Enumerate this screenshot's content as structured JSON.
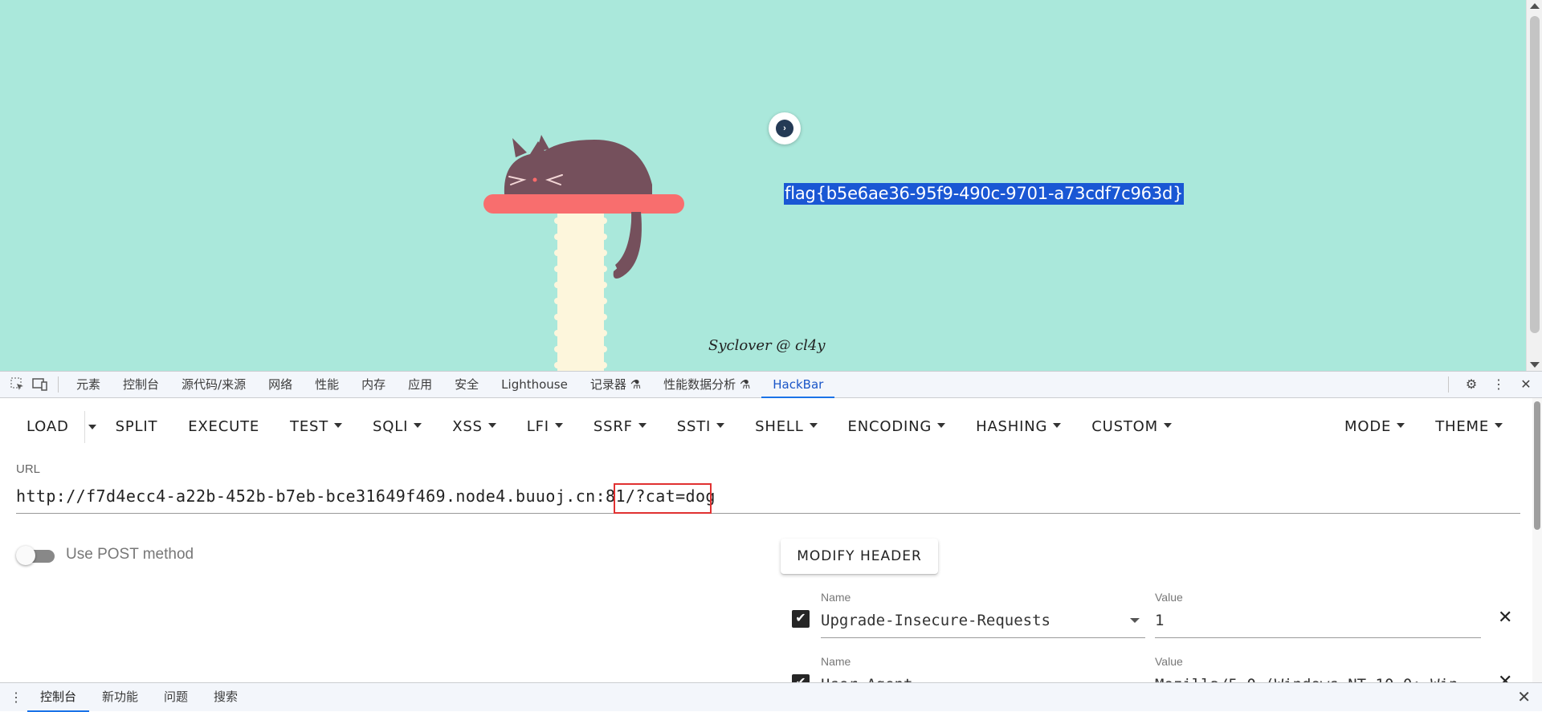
{
  "page": {
    "flag_text": "flag{b5e6ae36-95f9-490c-9701-a73cdf7c963d}",
    "credit": "Syclover @ cl4y",
    "background_color": "#aae8db"
  },
  "devtools": {
    "tabs": [
      "元素",
      "控制台",
      "源代码/来源",
      "网络",
      "性能",
      "内存",
      "应用",
      "安全",
      "Lighthouse",
      "记录器 ⚗",
      "性能数据分析 ⚗",
      "HackBar"
    ],
    "active_tab": "HackBar",
    "icons": [
      "inspect-icon",
      "device-toggle-icon",
      "gear-icon",
      "more-vert-icon",
      "close-icon"
    ]
  },
  "hackbar": {
    "toolbar": {
      "load": "LOAD",
      "split": "SPLIT",
      "execute": "EXECUTE",
      "test": "TEST",
      "sqli": "SQLI",
      "xss": "XSS",
      "lfi": "LFI",
      "ssrf": "SSRF",
      "ssti": "SSTI",
      "shell": "SHELL",
      "encoding": "ENCODING",
      "hashing": "HASHING",
      "custom": "CUSTOM",
      "mode": "MODE",
      "theme": "THEME"
    },
    "url_label": "URL",
    "url_value": "http://f7d4ecc4-a22b-452b-b7eb-bce31649f469.node4.buuoj.cn:81/?cat=dog",
    "url_highlighted_part": "/?cat=dog",
    "post_toggle_label": "Use POST method",
    "post_enabled": false,
    "modify_header_label": "MODIFY HEADER",
    "headers": [
      {
        "checked": true,
        "name_label": "Name",
        "name": "Upgrade-Insecure-Requests",
        "value_label": "Value",
        "value": "1"
      },
      {
        "checked": true,
        "name_label": "Name",
        "name": "User-Agent",
        "value_label": "Value",
        "value": "Mozilla/5.0 (Windows NT 10.0; Win"
      }
    ]
  },
  "drawer": {
    "tabs": [
      "控制台",
      "新功能",
      "问题",
      "搜索"
    ],
    "active_tab": "控制台"
  }
}
